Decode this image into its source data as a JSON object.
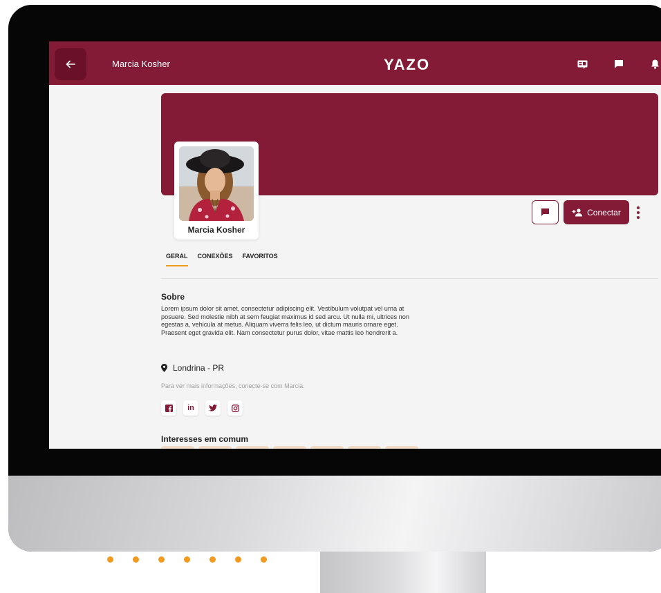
{
  "app": {
    "brand": "YAZO",
    "header_name": "Marcia Kosher"
  },
  "profile": {
    "name": "Marcia Kosher",
    "message_button_icon": "chat-icon",
    "connect_label": "Conectar"
  },
  "tabs": [
    {
      "label": "GERAL",
      "active": true
    },
    {
      "label": "CONEXÕES",
      "active": false
    },
    {
      "label": "FAVORITOS",
      "active": false
    }
  ],
  "about": {
    "title": "Sobre",
    "text": "Lorem ipsum dolor sit amet, consectetur adipiscing elit. Vestibulum volutpat vel urna at posuere. Sed molestie nibh at sem feugiat maximus id sed arcu. Ut nulla mi, ultrices non egestas a, vehicula at metus. Aliquam viverra felis leo, ut dictum mauris ornare eget. Praesent eget gravida elit. Nam consectetur purus dolor, vitae mattis leo hendrerit a."
  },
  "location": "Londrina - PR",
  "hint": "Para ver mais informações, conecte-se com Marcia.",
  "socials": [
    "facebook-icon",
    "linkedin-icon",
    "twitter-icon",
    "instagram-icon"
  ],
  "interests": {
    "title": "Interesses em comum"
  },
  "colors": {
    "brand": "#831a36",
    "accent": "#f29a1d",
    "background": "#f4f4f4"
  }
}
